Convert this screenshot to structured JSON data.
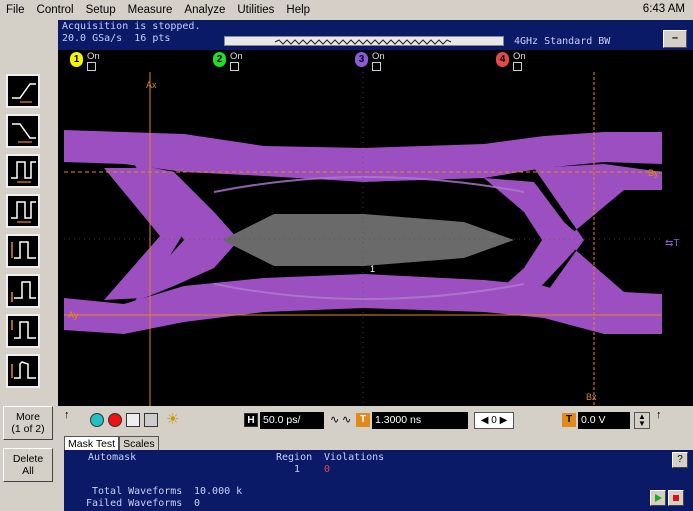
{
  "menu": {
    "items": [
      "File",
      "Control",
      "Setup",
      "Measure",
      "Analyze",
      "Utilities",
      "Help"
    ],
    "clock": "6:43 AM"
  },
  "status": {
    "line1": "Acquisition is stopped.",
    "rate": "20.0 GSa/s",
    "points": "16 pts",
    "bandwidth": "4GHz Standard BW",
    "minimize": "–"
  },
  "channels": [
    {
      "num": "1",
      "state": "On",
      "color": "#f5f500"
    },
    {
      "num": "2",
      "state": "On",
      "color": "#22dd22"
    },
    {
      "num": "3",
      "state": "On",
      "color": "#8c5cd8"
    },
    {
      "num": "4",
      "state": "On",
      "color": "#e04a4a"
    }
  ],
  "side_buttons": {
    "more": "More",
    "more_sub": "(1 of 2)",
    "delete": "Delete",
    "delete_sub": "All"
  },
  "markers": {
    "ax": "Ax",
    "bx": "Bx",
    "ay": "Ay",
    "by": "By",
    "trace": "1",
    "trigger": "T"
  },
  "controls": {
    "h_label": "H",
    "timebase": "50.0 ps/",
    "delay_label": "T",
    "delay": "1.3000 ns",
    "step": "0",
    "trig_label": "T",
    "trig_level": "0.0 V",
    "up": "↑"
  },
  "tabs": [
    "Mask Test",
    "Scales"
  ],
  "mask_test": {
    "automask": "Automask",
    "region_header": "Region",
    "violations_header": "Violations",
    "region": "1",
    "violations": "0",
    "total_label": "Total Waveforms",
    "total_value": "10.000 k",
    "failed_label": "Failed Waveforms",
    "failed_value": "0",
    "help": "?"
  },
  "colors": {
    "eye": "#9b4fc0",
    "marker": "#e08a1a",
    "mask": "#6a6a6a",
    "panel_bg": "#0a1a66"
  }
}
